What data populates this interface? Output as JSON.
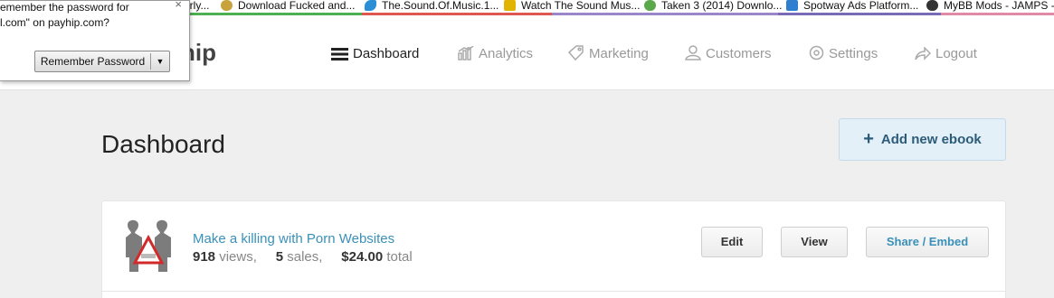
{
  "bookmarks": [
    {
      "label": "erly...",
      "color": "#7f4f9a"
    },
    {
      "label": "Download Fucked and...",
      "color": "#c8a23a"
    },
    {
      "label": "The.Sound.Of.Music.1...",
      "color": "#2a8fd6"
    },
    {
      "label": "Watch The Sound Mus...",
      "color": "#e0b400"
    },
    {
      "label": "Taken 3 (2014) Downlo...",
      "color": "#5aa84a"
    },
    {
      "label": "Spotway Ads Platform...",
      "color": "#2f7fd0"
    },
    {
      "label": "MyBB Mods - JAMPS -",
      "color": "#333333"
    }
  ],
  "password_prompt": {
    "line1": "emember the password for",
    "line2": "l.com\" on payhip.com?",
    "remember_label": "Remember Password",
    "close_glyph": "×",
    "dropdown_glyph": "▼"
  },
  "header": {
    "logo_text": "hip",
    "nav": [
      {
        "label": "Dashboard",
        "icon": "menu-icon",
        "active": true
      },
      {
        "label": "Analytics",
        "icon": "bar-chart-icon"
      },
      {
        "label": "Marketing",
        "icon": "tag-icon"
      },
      {
        "label": "Customers",
        "icon": "user-icon"
      },
      {
        "label": "Settings",
        "icon": "gear-icon"
      },
      {
        "label": "Logout",
        "icon": "share-arrow-icon"
      }
    ]
  },
  "main": {
    "title": "Dashboard",
    "add_button": {
      "icon": "plus-icon",
      "plus_glyph": "+",
      "label": "Add new ebook"
    }
  },
  "ebook": {
    "title": "Make a killing with Porn Websites",
    "views_count": "918",
    "views_label": "views,",
    "sales_count": "5",
    "sales_label": "sales,",
    "price": "$24.00",
    "price_label": "total",
    "buttons": {
      "edit": "Edit",
      "view": "View",
      "share": "Share / Embed"
    }
  },
  "colors": {
    "accent": "#3a90b8",
    "add_button_bg": "#e3f0f7",
    "add_button_text": "#2c5c7a"
  }
}
